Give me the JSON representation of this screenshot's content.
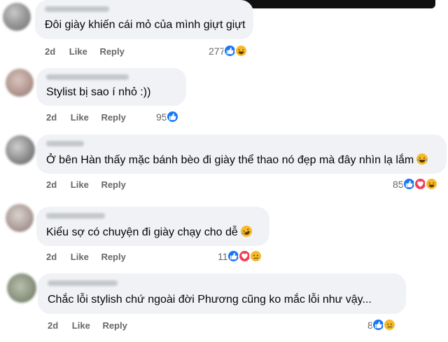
{
  "comments": [
    {
      "text": "Đôi giày khiến cái mỏ của mình giựt giựt",
      "time": "2d",
      "like": "Like",
      "reply": "Reply",
      "reaction_count": "277",
      "reactions": [
        "like-icon",
        "haha-icon"
      ]
    },
    {
      "text": "Stylist bị sao í nhỏ :))",
      "time": "2d",
      "like": "Like",
      "reply": "Reply",
      "reaction_count": "95",
      "reactions": [
        "like-icon"
      ]
    },
    {
      "text": "Ở bên Hàn thấy mặc bánh bèo đi giày thể thao nó đẹp mà đây nhìn lạ lắm",
      "time": "2d",
      "like": "Like",
      "reply": "Reply",
      "reaction_count": "85",
      "reactions": [
        "like-icon",
        "love-icon",
        "haha-icon"
      ]
    },
    {
      "text": "Kiểu sợ có chuyện đi giày chạy cho dễ",
      "time": "2d",
      "like": "Like",
      "reply": "Reply",
      "reaction_count": "11",
      "reactions": [
        "like-icon",
        "love-icon",
        "sad-icon"
      ]
    },
    {
      "text": "Chắc lỗi stylish chứ ngoài đời Phương cũng ko mắc lỗi như vậy...",
      "time": "2d",
      "like": "Like",
      "reply": "Reply",
      "reaction_count": "8",
      "reactions": [
        "like-icon",
        "sad-icon"
      ]
    }
  ],
  "colors": {
    "bubble": "#f0f2f5",
    "like": "#1877f2",
    "love": "#f33e58",
    "haha": "#f7b928",
    "meta_text": "#65676b"
  }
}
